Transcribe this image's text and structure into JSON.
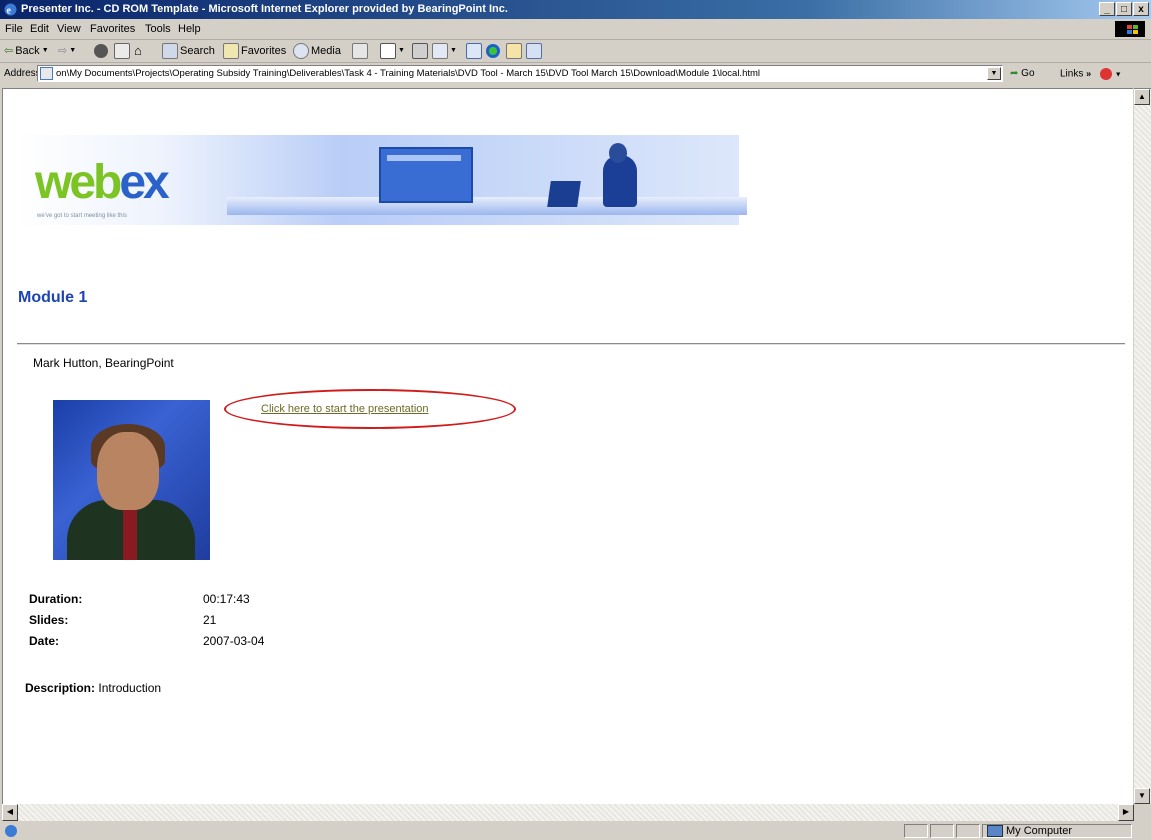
{
  "window": {
    "title": "Presenter Inc. - CD ROM Template - Microsoft Internet Explorer provided by BearingPoint Inc.",
    "buttons": [
      "_",
      "□",
      "x"
    ]
  },
  "menu": [
    "File",
    "Edit",
    "View",
    "Favorites",
    "Tools",
    "Help"
  ],
  "toolbar": {
    "back": "Back",
    "search": "Search",
    "favorites": "Favorites",
    "media": "Media"
  },
  "address": {
    "label": "Address",
    "url": "on\\My Documents\\Projects\\Operating Subsidy Training\\Deliverables\\Task 4 - Training Materials\\DVD Tool - March 15\\DVD Tool March 15\\Download\\Module 1\\local.html",
    "go": "Go",
    "links": "Links"
  },
  "banner": {
    "logo_main": "web",
    "logo_accent": "ex",
    "tagline": "we've got to start meeting like this"
  },
  "page": {
    "heading": "Module 1",
    "presenter": "Mark Hutton, BearingPoint",
    "start_link": "Click here to start the presentation",
    "duration_label": "Duration:",
    "duration_value": "00:17:43",
    "slides_label": "Slides:",
    "slides_value": "21",
    "date_label": "Date:",
    "date_value": "2007-03-04",
    "description_label": "Description:",
    "description_value": "Introduction"
  },
  "status": {
    "zone": "My Computer"
  },
  "colors": {
    "title_bar": "#0a246a",
    "heading": "#1c45b3",
    "link": "#6b6b2a",
    "highlight_oval": "#d11a1a",
    "logo_green": "#7bc424",
    "logo_blue": "#2a62c9"
  }
}
